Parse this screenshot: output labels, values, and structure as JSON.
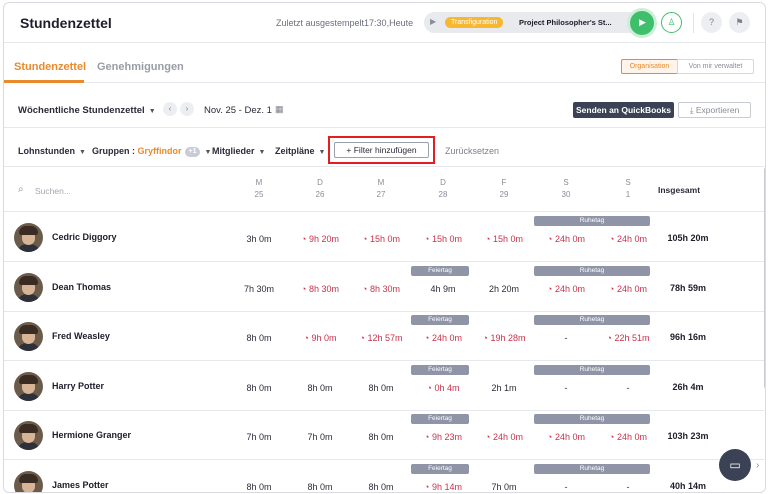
{
  "app": {
    "title": "Stundenzettel"
  },
  "header": {
    "clock_status": "Zuletzt ausgestempelt17:30,Heute",
    "timer": {
      "tag": "Transfiguration",
      "project": "Project Philosopher's St..."
    }
  },
  "tabs": {
    "timesheets": "Stundenzettel",
    "approvals": "Genehmigungen"
  },
  "scope": {
    "organisation": "Organisation",
    "managed": "Von mir verwaltet"
  },
  "toolbar": {
    "period": "Wöchentliche Stundenzettel",
    "date_range": "Nov. 25 - Dez. 1",
    "send_quickbooks": "Senden an QuickBooks",
    "export": "Exportieren"
  },
  "filters": {
    "pay": "Lohnstunden",
    "groups_label": "Gruppen",
    "groups_value": "Gryffindor",
    "groups_extra": "+1",
    "members": "Mitglieder",
    "schedules": "Zeitpläne",
    "add_filter": "Filter hinzufügen",
    "reset": "Zurücksetzen"
  },
  "table": {
    "search_placeholder": "Suchen...",
    "total_header": "Insgesamt",
    "days": [
      {
        "dow": "M",
        "date": "25"
      },
      {
        "dow": "D",
        "date": "26"
      },
      {
        "dow": "M",
        "date": "27"
      },
      {
        "dow": "D",
        "date": "28"
      },
      {
        "dow": "F",
        "date": "29"
      },
      {
        "dow": "S",
        "date": "30"
      },
      {
        "dow": "S",
        "date": "1"
      }
    ],
    "badges": {
      "holiday": "Feiertag",
      "rest": "Ruhetag"
    },
    "rows": [
      {
        "name": "Cedric Diggory",
        "total": "105h 20m",
        "holiday": false,
        "cells": [
          {
            "v": "3h 0m",
            "w": false
          },
          {
            "v": "9h 20m",
            "w": true
          },
          {
            "v": "15h 0m",
            "w": true
          },
          {
            "v": "15h 0m",
            "w": true
          },
          {
            "v": "15h 0m",
            "w": true
          },
          {
            "v": "24h 0m",
            "w": true
          },
          {
            "v": "24h 0m",
            "w": true
          }
        ]
      },
      {
        "name": "Dean Thomas",
        "total": "78h 59m",
        "holiday": true,
        "cells": [
          {
            "v": "7h 30m",
            "w": false
          },
          {
            "v": "8h 30m",
            "w": true
          },
          {
            "v": "8h 30m",
            "w": true
          },
          {
            "v": "4h 9m",
            "w": false
          },
          {
            "v": "2h 20m",
            "w": false
          },
          {
            "v": "24h 0m",
            "w": true
          },
          {
            "v": "24h 0m",
            "w": true
          }
        ]
      },
      {
        "name": "Fred Weasley",
        "total": "96h 16m",
        "holiday": true,
        "cells": [
          {
            "v": "8h 0m",
            "w": false
          },
          {
            "v": "9h 0m",
            "w": true
          },
          {
            "v": "12h 57m",
            "w": true
          },
          {
            "v": "24h 0m",
            "w": true
          },
          {
            "v": "19h 28m",
            "w": true
          },
          {
            "v": "-",
            "w": false
          },
          {
            "v": "22h 51m",
            "w": true
          }
        ]
      },
      {
        "name": "Harry Potter",
        "total": "26h 4m",
        "holiday": true,
        "cells": [
          {
            "v": "8h 0m",
            "w": false
          },
          {
            "v": "8h 0m",
            "w": false
          },
          {
            "v": "8h 0m",
            "w": false
          },
          {
            "v": "0h 4m",
            "w": true
          },
          {
            "v": "2h 1m",
            "w": false
          },
          {
            "v": "-",
            "w": false
          },
          {
            "v": "-",
            "w": false
          }
        ]
      },
      {
        "name": "Hermione Granger",
        "total": "103h 23m",
        "holiday": true,
        "cells": [
          {
            "v": "7h 0m",
            "w": false
          },
          {
            "v": "7h 0m",
            "w": false
          },
          {
            "v": "8h 0m",
            "w": false
          },
          {
            "v": "9h 23m",
            "w": true
          },
          {
            "v": "24h 0m",
            "w": true
          },
          {
            "v": "24h 0m",
            "w": true
          },
          {
            "v": "24h 0m",
            "w": true
          }
        ]
      },
      {
        "name": "James Potter",
        "total": "40h 14m",
        "holiday": true,
        "cells": [
          {
            "v": "8h 0m",
            "w": false
          },
          {
            "v": "8h 0m",
            "w": false
          },
          {
            "v": "8h 0m",
            "w": false
          },
          {
            "v": "9h 14m",
            "w": true
          },
          {
            "v": "7h 0m",
            "w": false
          },
          {
            "v": "-",
            "w": false
          },
          {
            "v": "-",
            "w": false
          }
        ]
      }
    ]
  }
}
